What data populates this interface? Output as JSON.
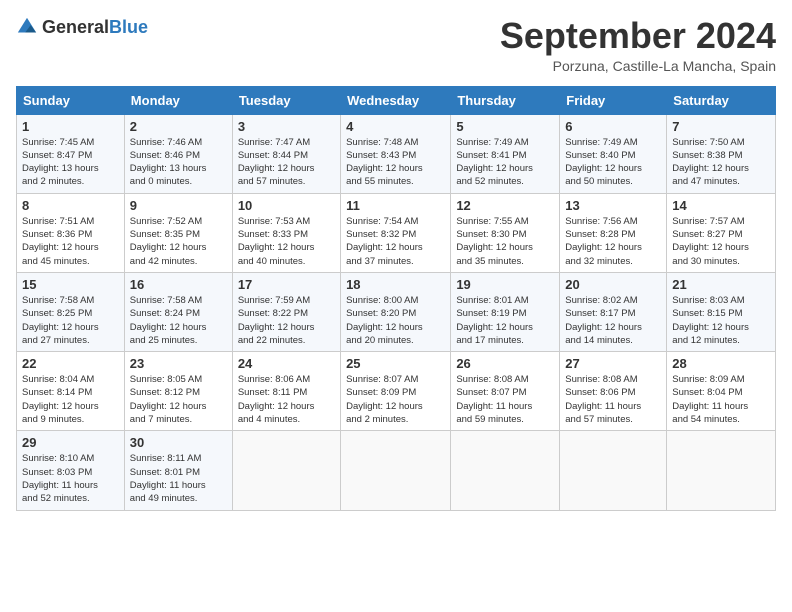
{
  "header": {
    "logo_general": "General",
    "logo_blue": "Blue",
    "month_title": "September 2024",
    "location": "Porzuna, Castille-La Mancha, Spain"
  },
  "calendar": {
    "days_of_week": [
      "Sunday",
      "Monday",
      "Tuesday",
      "Wednesday",
      "Thursday",
      "Friday",
      "Saturday"
    ],
    "weeks": [
      [
        {
          "day": "",
          "info": ""
        },
        {
          "day": "2",
          "info": "Sunrise: 7:46 AM\nSunset: 8:46 PM\nDaylight: 13 hours\nand 0 minutes."
        },
        {
          "day": "3",
          "info": "Sunrise: 7:47 AM\nSunset: 8:44 PM\nDaylight: 12 hours\nand 57 minutes."
        },
        {
          "day": "4",
          "info": "Sunrise: 7:48 AM\nSunset: 8:43 PM\nDaylight: 12 hours\nand 55 minutes."
        },
        {
          "day": "5",
          "info": "Sunrise: 7:49 AM\nSunset: 8:41 PM\nDaylight: 12 hours\nand 52 minutes."
        },
        {
          "day": "6",
          "info": "Sunrise: 7:49 AM\nSunset: 8:40 PM\nDaylight: 12 hours\nand 50 minutes."
        },
        {
          "day": "7",
          "info": "Sunrise: 7:50 AM\nSunset: 8:38 PM\nDaylight: 12 hours\nand 47 minutes."
        }
      ],
      [
        {
          "day": "1",
          "info": "Sunrise: 7:45 AM\nSunset: 8:47 PM\nDaylight: 13 hours\nand 2 minutes."
        },
        {
          "day": "",
          "info": ""
        },
        {
          "day": "",
          "info": ""
        },
        {
          "day": "",
          "info": ""
        },
        {
          "day": "",
          "info": ""
        },
        {
          "day": "",
          "info": ""
        },
        {
          "day": "",
          "info": ""
        }
      ],
      [
        {
          "day": "8",
          "info": "Sunrise: 7:51 AM\nSunset: 8:36 PM\nDaylight: 12 hours\nand 45 minutes."
        },
        {
          "day": "9",
          "info": "Sunrise: 7:52 AM\nSunset: 8:35 PM\nDaylight: 12 hours\nand 42 minutes."
        },
        {
          "day": "10",
          "info": "Sunrise: 7:53 AM\nSunset: 8:33 PM\nDaylight: 12 hours\nand 40 minutes."
        },
        {
          "day": "11",
          "info": "Sunrise: 7:54 AM\nSunset: 8:32 PM\nDaylight: 12 hours\nand 37 minutes."
        },
        {
          "day": "12",
          "info": "Sunrise: 7:55 AM\nSunset: 8:30 PM\nDaylight: 12 hours\nand 35 minutes."
        },
        {
          "day": "13",
          "info": "Sunrise: 7:56 AM\nSunset: 8:28 PM\nDaylight: 12 hours\nand 32 minutes."
        },
        {
          "day": "14",
          "info": "Sunrise: 7:57 AM\nSunset: 8:27 PM\nDaylight: 12 hours\nand 30 minutes."
        }
      ],
      [
        {
          "day": "15",
          "info": "Sunrise: 7:58 AM\nSunset: 8:25 PM\nDaylight: 12 hours\nand 27 minutes."
        },
        {
          "day": "16",
          "info": "Sunrise: 7:58 AM\nSunset: 8:24 PM\nDaylight: 12 hours\nand 25 minutes."
        },
        {
          "day": "17",
          "info": "Sunrise: 7:59 AM\nSunset: 8:22 PM\nDaylight: 12 hours\nand 22 minutes."
        },
        {
          "day": "18",
          "info": "Sunrise: 8:00 AM\nSunset: 8:20 PM\nDaylight: 12 hours\nand 20 minutes."
        },
        {
          "day": "19",
          "info": "Sunrise: 8:01 AM\nSunset: 8:19 PM\nDaylight: 12 hours\nand 17 minutes."
        },
        {
          "day": "20",
          "info": "Sunrise: 8:02 AM\nSunset: 8:17 PM\nDaylight: 12 hours\nand 14 minutes."
        },
        {
          "day": "21",
          "info": "Sunrise: 8:03 AM\nSunset: 8:15 PM\nDaylight: 12 hours\nand 12 minutes."
        }
      ],
      [
        {
          "day": "22",
          "info": "Sunrise: 8:04 AM\nSunset: 8:14 PM\nDaylight: 12 hours\nand 9 minutes."
        },
        {
          "day": "23",
          "info": "Sunrise: 8:05 AM\nSunset: 8:12 PM\nDaylight: 12 hours\nand 7 minutes."
        },
        {
          "day": "24",
          "info": "Sunrise: 8:06 AM\nSunset: 8:11 PM\nDaylight: 12 hours\nand 4 minutes."
        },
        {
          "day": "25",
          "info": "Sunrise: 8:07 AM\nSunset: 8:09 PM\nDaylight: 12 hours\nand 2 minutes."
        },
        {
          "day": "26",
          "info": "Sunrise: 8:08 AM\nSunset: 8:07 PM\nDaylight: 11 hours\nand 59 minutes."
        },
        {
          "day": "27",
          "info": "Sunrise: 8:08 AM\nSunset: 8:06 PM\nDaylight: 11 hours\nand 57 minutes."
        },
        {
          "day": "28",
          "info": "Sunrise: 8:09 AM\nSunset: 8:04 PM\nDaylight: 11 hours\nand 54 minutes."
        }
      ],
      [
        {
          "day": "29",
          "info": "Sunrise: 8:10 AM\nSunset: 8:03 PM\nDaylight: 11 hours\nand 52 minutes."
        },
        {
          "day": "30",
          "info": "Sunrise: 8:11 AM\nSunset: 8:01 PM\nDaylight: 11 hours\nand 49 minutes."
        },
        {
          "day": "",
          "info": ""
        },
        {
          "day": "",
          "info": ""
        },
        {
          "day": "",
          "info": ""
        },
        {
          "day": "",
          "info": ""
        },
        {
          "day": "",
          "info": ""
        }
      ]
    ]
  }
}
